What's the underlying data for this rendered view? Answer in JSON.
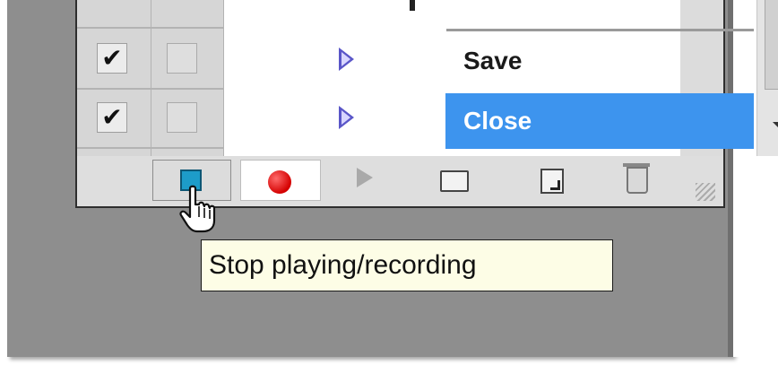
{
  "actions_panel": {
    "items": [
      {
        "label": "Save",
        "checked": true,
        "selected": false
      },
      {
        "label": "Close",
        "checked": true,
        "selected": true
      }
    ],
    "checkmark_glyph": "✔",
    "toolbar": {
      "stop_button": "stop-icon",
      "record_button": "record-icon",
      "play_button": "play-icon",
      "new_set_button": "folder-icon",
      "new_action_button": "new-action-icon",
      "delete_button": "trash-icon"
    },
    "selection_color": "#3d94ee",
    "record_color": "#d40000",
    "stop_color": "#1d9cc9"
  },
  "tooltip": {
    "text": "Stop playing/recording"
  }
}
